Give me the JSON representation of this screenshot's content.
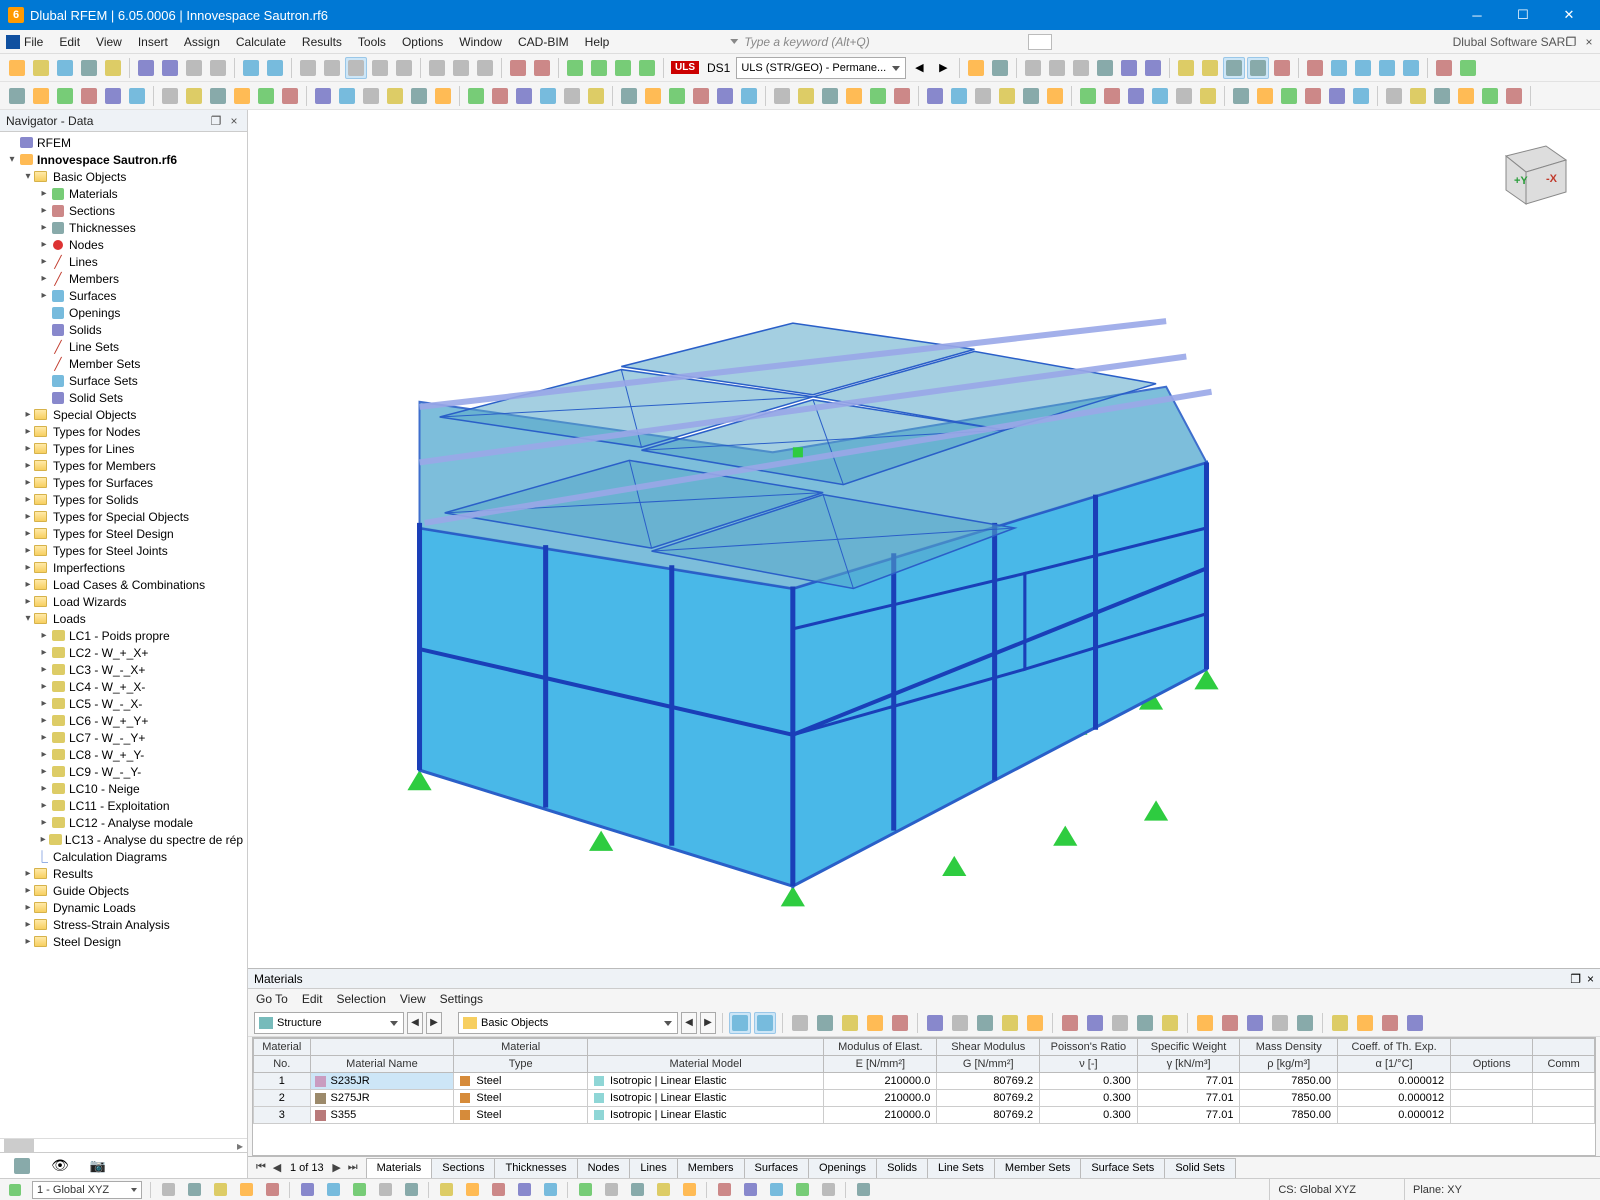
{
  "window": {
    "title": "Dlubal RFEM | 6.05.0006 | Innovespace Sautron.rf6",
    "company": "Dlubal Software SARL",
    "keyword_placeholder": "Type a keyword (Alt+Q)"
  },
  "menus": [
    "File",
    "Edit",
    "View",
    "Insert",
    "Assign",
    "Calculate",
    "Results",
    "Tools",
    "Options",
    "Window",
    "CAD-BIM",
    "Help"
  ],
  "loadcase_badge": "ULS",
  "loadcase_id": "DS1",
  "loadcase_combo": "ULS (STR/GEO) - Permane...",
  "navigator": {
    "title": "Navigator - Data",
    "root": "RFEM",
    "model": "Innovespace Sautron.rf6",
    "basic_objects_label": "Basic Objects",
    "basic_objects": [
      "Materials",
      "Sections",
      "Thicknesses",
      "Nodes",
      "Lines",
      "Members",
      "Surfaces",
      "Openings",
      "Solids",
      "Line Sets",
      "Member Sets",
      "Surface Sets",
      "Solid Sets"
    ],
    "folders_mid": [
      "Special Objects",
      "Types for Nodes",
      "Types for Lines",
      "Types for Members",
      "Types for Surfaces",
      "Types for Solids",
      "Types for Special Objects",
      "Types for Steel Design",
      "Types for Steel Joints",
      "Imperfections",
      "Load Cases & Combinations",
      "Load Wizards"
    ],
    "loads_label": "Loads",
    "loads": [
      "LC1 - Poids propre",
      "LC2 - W_+_X+",
      "LC3 - W_-_X+",
      "LC4 - W_+_X-",
      "LC5 - W_-_X-",
      "LC6 - W_+_Y+",
      "LC7 - W_-_Y+",
      "LC8 - W_+_Y-",
      "LC9 - W_-_Y-",
      "LC10 - Neige",
      "LC11 - Exploitation",
      "LC12 - Analyse modale",
      "LC13 - Analyse du spectre de rép"
    ],
    "calc_diagrams": "Calculation Diagrams",
    "folders_end": [
      "Results",
      "Guide Objects",
      "Dynamic Loads",
      "Stress-Strain Analysis",
      "Steel Design"
    ]
  },
  "materials_panel": {
    "title": "Materials",
    "menus": [
      "Go To",
      "Edit",
      "Selection",
      "View",
      "Settings"
    ],
    "combo_left": "Structure",
    "combo_right": "Basic Objects",
    "pager": "1 of 13",
    "tabs": [
      "Materials",
      "Sections",
      "Thicknesses",
      "Nodes",
      "Lines",
      "Members",
      "Surfaces",
      "Openings",
      "Solids",
      "Line Sets",
      "Member Sets",
      "Surface Sets",
      "Solid Sets"
    ],
    "header_top": [
      "Material",
      "",
      "Material",
      "",
      "Modulus of Elast.",
      "Shear Modulus",
      "Poisson's Ratio",
      "Specific Weight",
      "Mass Density",
      "Coeff. of Th. Exp.",
      "",
      ""
    ],
    "header_bot": [
      "No.",
      "Material Name",
      "Type",
      "Material Model",
      "E [N/mm²]",
      "G [N/mm²]",
      "ν [-]",
      "γ [kN/m³]",
      "ρ [kg/m³]",
      "α [1/°C]",
      "Options",
      "Comm"
    ],
    "rows": [
      {
        "no": 1,
        "name": "S235JR",
        "sw": "#c99cc0",
        "type": "Steel",
        "model": "Isotropic | Linear Elastic",
        "E": "210000.0",
        "G": "80769.2",
        "v": "0.300",
        "gamma": "77.01",
        "rho": "7850.00",
        "alpha": "0.000012",
        "sel": true
      },
      {
        "no": 2,
        "name": "S275JR",
        "sw": "#9c8a6b",
        "type": "Steel",
        "model": "Isotropic | Linear Elastic",
        "E": "210000.0",
        "G": "80769.2",
        "v": "0.300",
        "gamma": "77.01",
        "rho": "7850.00",
        "alpha": "0.000012"
      },
      {
        "no": 3,
        "name": "S355",
        "sw": "#b97a7a",
        "type": "Steel",
        "model": "Isotropic | Linear Elastic",
        "E": "210000.0",
        "G": "80769.2",
        "v": "0.300",
        "gamma": "77.01",
        "rho": "7850.00",
        "alpha": "0.000012"
      }
    ]
  },
  "status": {
    "cs_combo": "1 - Global XYZ",
    "cs_label": "CS: Global XYZ",
    "plane_label": "Plane: XY"
  }
}
